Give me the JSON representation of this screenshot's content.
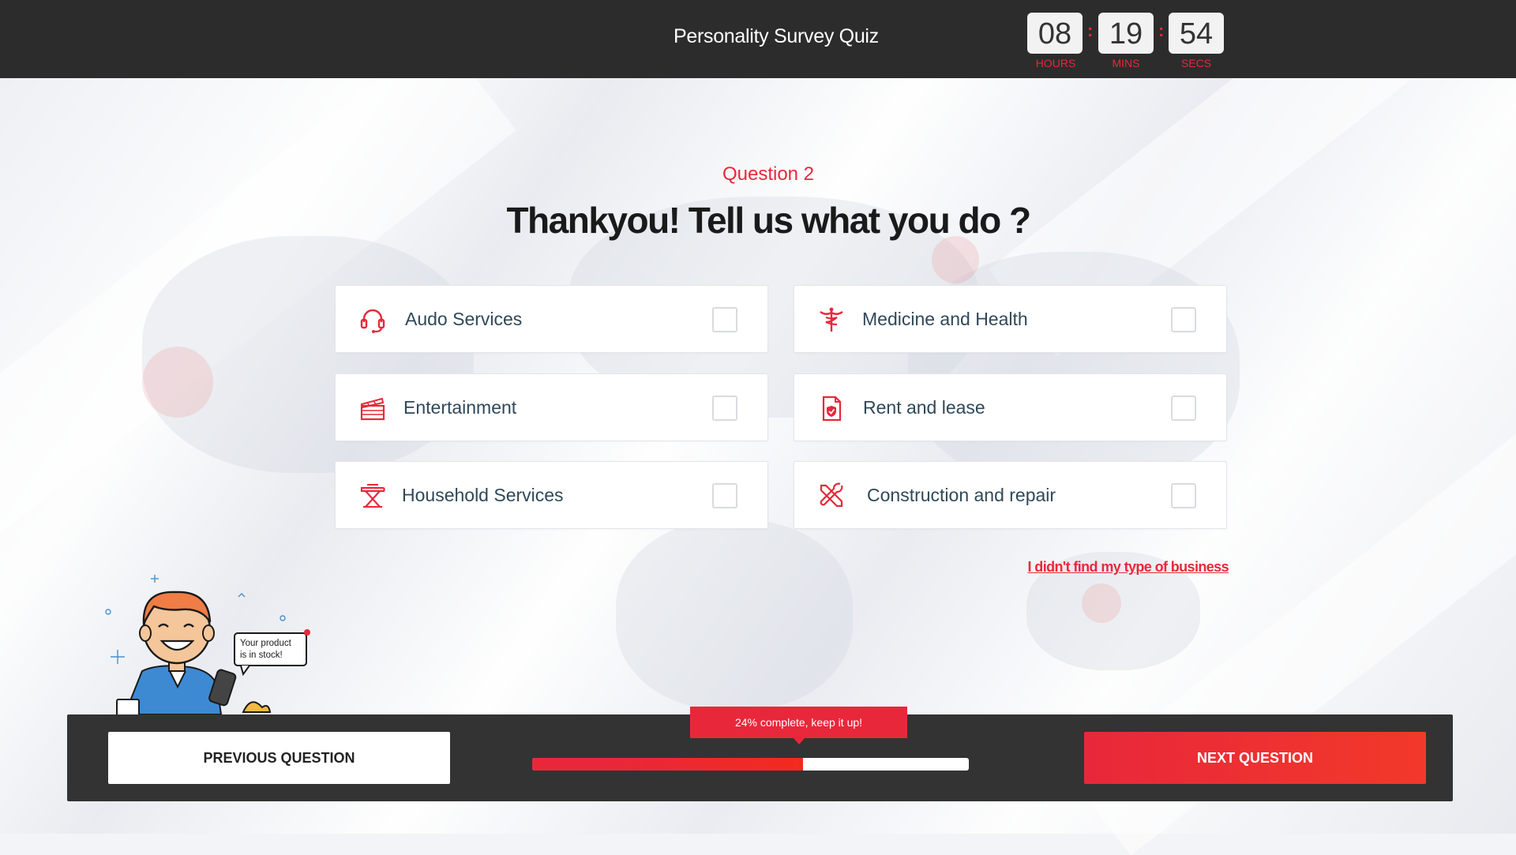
{
  "header": {
    "title": "Personality Survey Quiz",
    "timer": {
      "hours": "08",
      "mins": "19",
      "secs": "54",
      "hours_label": "HOURS",
      "mins_label": "MINS",
      "secs_label": "SECS"
    }
  },
  "question": {
    "number": "Question 2",
    "text": "Thankyou! Tell us what you do ?"
  },
  "options": [
    {
      "label": "Audo Services",
      "icon": "headset-icon",
      "checked": false
    },
    {
      "label": "Medicine and Health",
      "icon": "caduceus-icon",
      "checked": false
    },
    {
      "label": "Entertainment",
      "icon": "clapperboard-icon",
      "checked": false
    },
    {
      "label": "Rent and lease",
      "icon": "document-shield-icon",
      "checked": false
    },
    {
      "label": "Household Services",
      "icon": "ironing-board-icon",
      "checked": false
    },
    {
      "label": "Construction and repair",
      "icon": "tools-icon",
      "checked": false
    }
  ],
  "not_found_link": "I didn't find my type of business",
  "illustration": {
    "speech": [
      "Your product",
      "is in stock!"
    ]
  },
  "footer": {
    "prev_label": "PREVIOUS QUESTION",
    "next_label": "NEXT QUESTION",
    "progress_text": "24% complete, keep it up!",
    "progress_fraction": 0.62
  },
  "colors": {
    "accent": "#e8283a",
    "header_bg": "#2c2c2c",
    "footer_bg": "#333333",
    "option_text": "#2f4858"
  }
}
